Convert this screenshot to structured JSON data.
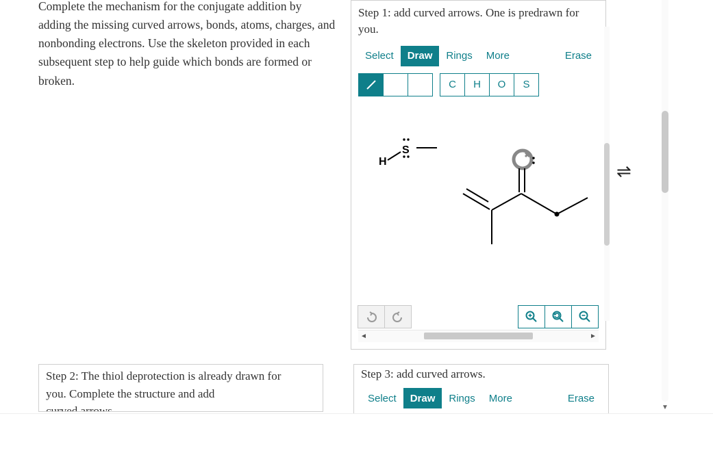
{
  "prompt": "Complete the mechanism for the conjugate addition by adding the missing curved arrows, bonds, atoms, charges, and nonbonding electrons. Use the skeleton provided in each subsequent step to help guide which bonds are formed or broken.",
  "step1": {
    "title": "Step 1: add curved arrows. One is predrawn for you.",
    "tabs": {
      "select": "Select",
      "draw": "Draw",
      "rings": "Rings",
      "more": "More"
    },
    "erase": "Erase",
    "atoms": [
      "C",
      "H",
      "O",
      "S"
    ],
    "canvas_labels": {
      "H": "H",
      "S": "S"
    }
  },
  "step2": {
    "text_line1": "Step 2: The thiol deprotection is already drawn for",
    "text_line2": "you. Complete the structure and add",
    "text_line3": "curved arrows"
  },
  "step3": {
    "title": "Step 3: add curved arrows.",
    "tabs": {
      "select": "Select",
      "draw": "Draw",
      "rings": "Rings",
      "more": "More"
    },
    "erase": "Erase"
  },
  "equilibrium": "⇌",
  "colors": {
    "teal": "#0f7f8a",
    "gray": "#888"
  }
}
